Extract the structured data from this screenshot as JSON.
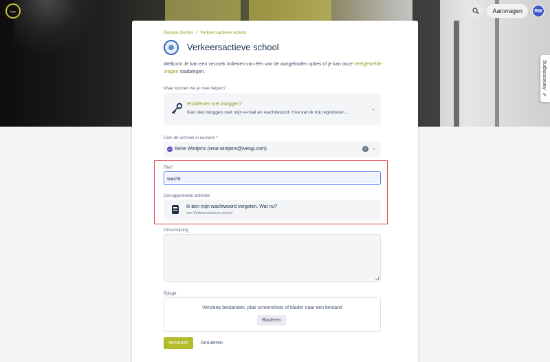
{
  "header": {
    "logo_text": "logo",
    "requests_label": "Aanvragen",
    "avatar_initials": "RW",
    "side_tab_label": "Aankondiging"
  },
  "breadcrumb": [
    {
      "label": "Service Center"
    },
    {
      "label": "Verkeersactieve school"
    }
  ],
  "page": {
    "title": "Verkeersactieve school",
    "intro_text": "Welkom! Je kan een verzoek indienen van één van de aangeboden opties of je kan onze",
    "intro_link": "Veelgestelde vragen",
    "intro_suffix": "raadplegen."
  },
  "form": {
    "help_label": "Waar kunnen we je mee helpen?",
    "request_type": {
      "title": "Problemen met inloggen?",
      "description": "Kan niet inloggen met mijn e-mail en wachtwoord. Hoe kan ik mij registreren..."
    },
    "on_behalf_label": "Dien dit verzoek in namens",
    "on_behalf_value": "Rene Wintjens (rene.wintjens@ivengi.com)",
    "mini_avatar_initials": "RW",
    "title_label": "Titel",
    "title_value": "wacht",
    "suggested_label": "Gesuggereerde artikelen",
    "suggested": [
      {
        "title": "Ik ben mijn wachtwoord vergeten. Wat nu?",
        "source": "van Verkeersactieve school"
      }
    ],
    "description_label": "Omschrijving",
    "attachment_label": "Bijlage",
    "drop_text": "Versleep bestanden, plak screenshots of blader naar een bestand",
    "browse_label": "Bladeren",
    "submit_label": "Versturen",
    "cancel_label": "Annuleren",
    "required_mark": "*"
  },
  "colors": {
    "accent": "#b3bb2c",
    "link": "#9a9a1e",
    "highlight_border": "#e03b3b",
    "focus": "#4c6fff",
    "avatar": "#3b58c6"
  },
  "icons": [
    "search-icon",
    "key-icon",
    "chevron-down-icon",
    "clear-icon",
    "article-icon",
    "pencil-icon",
    "resize-handle-icon"
  ]
}
